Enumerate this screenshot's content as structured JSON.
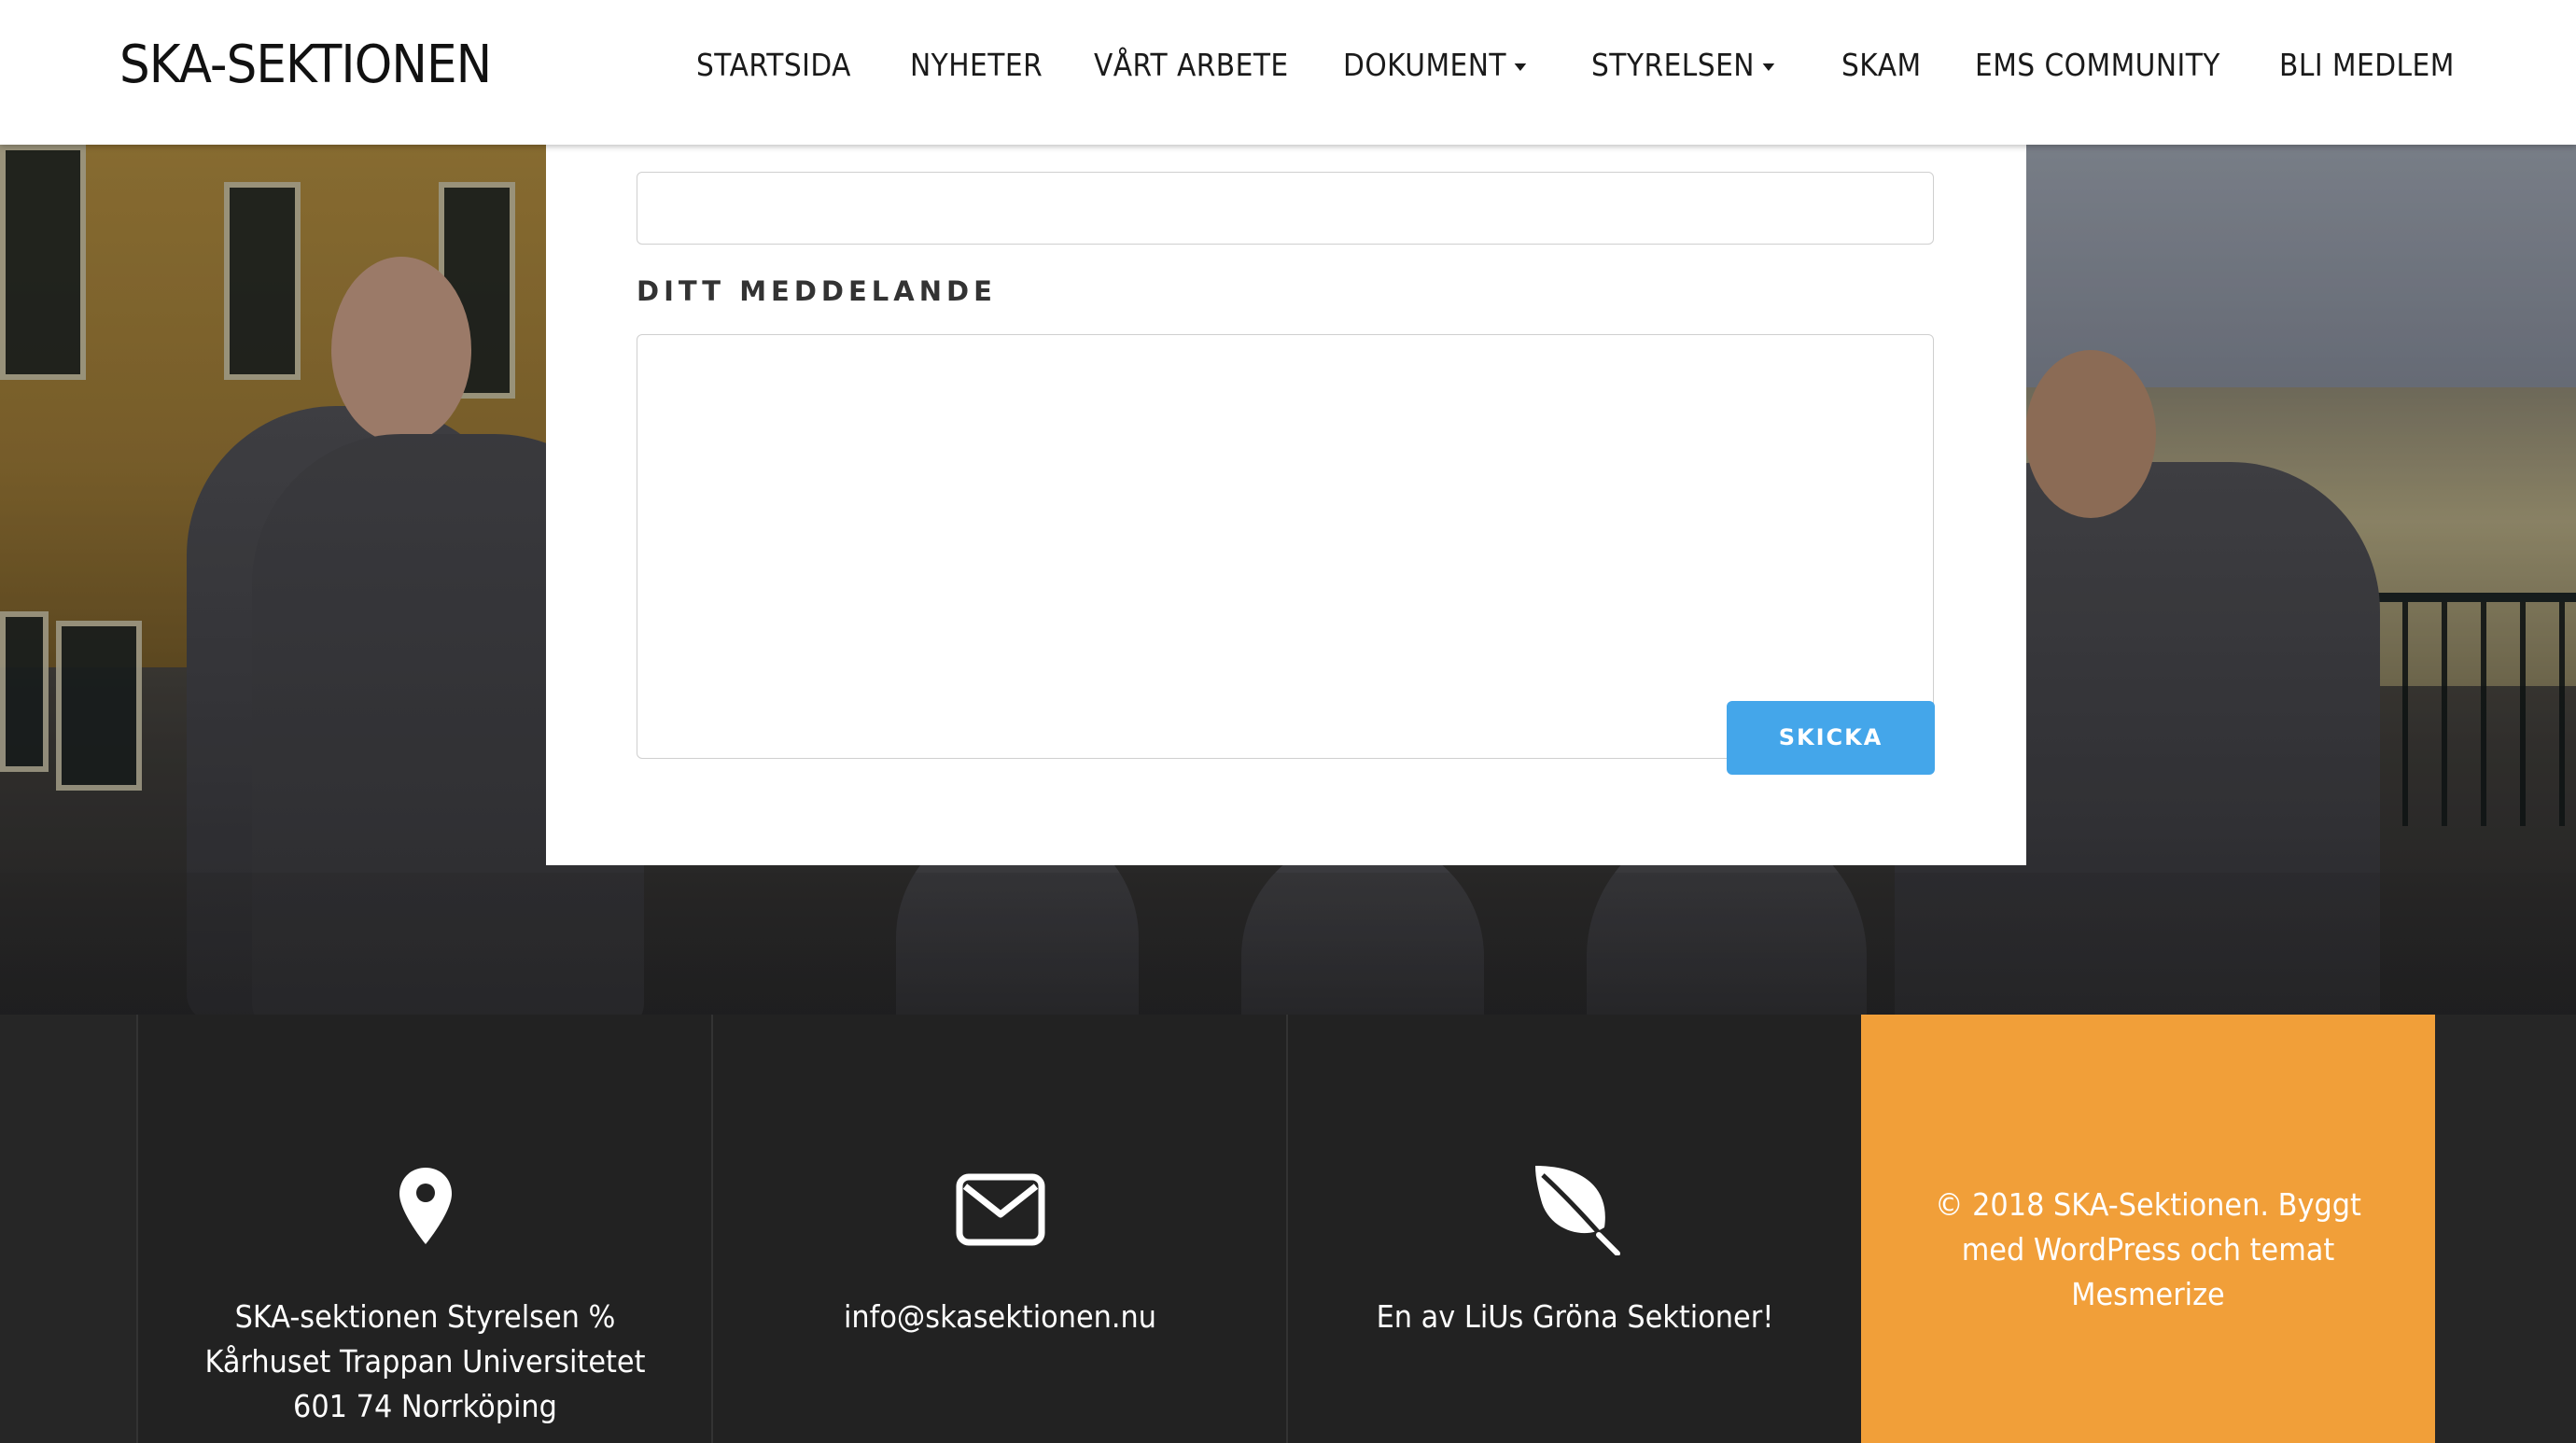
{
  "header": {
    "logo": "SKA-SEKTIONEN",
    "nav": [
      {
        "label": "STARTSIDA",
        "dropdown": false
      },
      {
        "label": "NYHETER",
        "dropdown": false
      },
      {
        "label": "VÅRT ARBETE",
        "dropdown": false
      },
      {
        "label": "DOKUMENT",
        "dropdown": true
      },
      {
        "label": "STYRELSEN",
        "dropdown": true
      },
      {
        "label": "SKAM",
        "dropdown": false
      },
      {
        "label": "EMS COMMUNITY",
        "dropdown": false
      },
      {
        "label": "BLI MEDLEM",
        "dropdown": false
      }
    ]
  },
  "form": {
    "subject_value": "",
    "message_label": "DITT MEDDELANDE",
    "message_value": "",
    "submit_label": "SKICKA"
  },
  "footer": {
    "address": {
      "icon": "map-pin-icon",
      "text": "SKA-sektionen Styrelsen % Kårhuset Trappan Universitetet 601 74 Norrköping"
    },
    "email": {
      "icon": "envelope-icon",
      "text": "info@skasektionen.nu"
    },
    "green": {
      "icon": "leaf-icon",
      "text": "En av LiUs Gröna Sektioner!"
    },
    "copyright": {
      "text": "©  2018 SKA-Sektionen. Byggt med WordPress och temat Mesmerize"
    }
  },
  "colors": {
    "accent_button": "#44a6ea",
    "footer_highlight": "#f19f39",
    "footer_bg": "#222222"
  }
}
